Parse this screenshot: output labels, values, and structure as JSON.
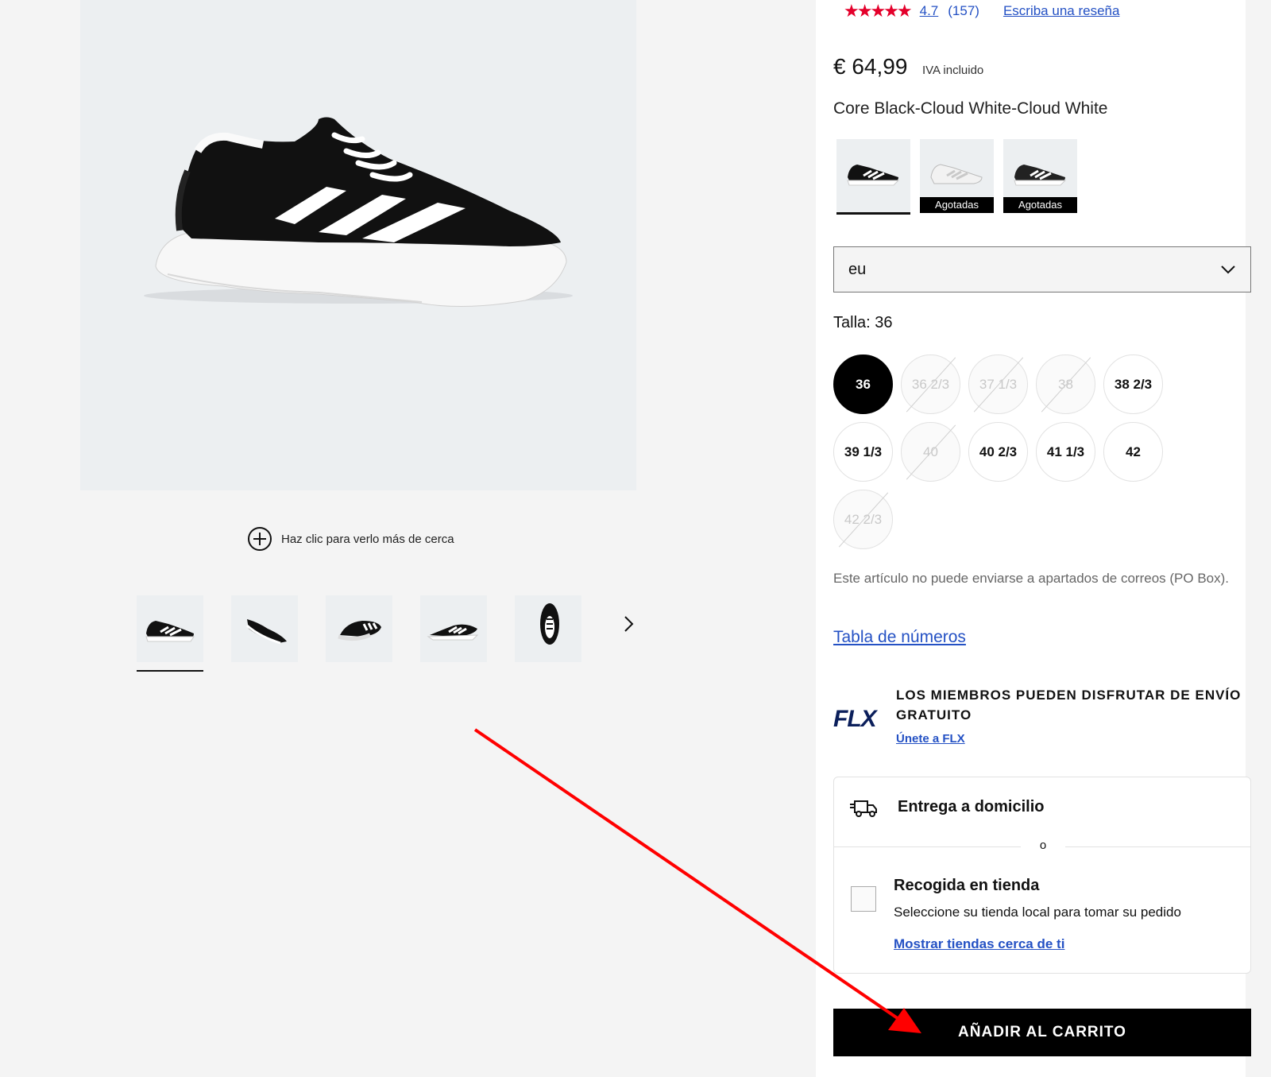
{
  "rating": {
    "stars": "★★★★★",
    "value": "4.7",
    "count": "(157)",
    "write_review": "Escriba una reseña"
  },
  "price": {
    "amount": "€ 64,99",
    "vat": "IVA incluido"
  },
  "color_name": "Core Black-Cloud White-Cloud White",
  "swatches": [
    {
      "tag": ""
    },
    {
      "tag": "Agotadas"
    },
    {
      "tag": "Agotadas"
    }
  ],
  "size_system": {
    "value": "eu"
  },
  "size_label": "Talla: 36",
  "sizes": [
    {
      "label": "36",
      "state": "selected"
    },
    {
      "label": "36 2/3",
      "state": "unavailable"
    },
    {
      "label": "37 1/3",
      "state": "unavailable"
    },
    {
      "label": "38",
      "state": "unavailable"
    },
    {
      "label": "38 2/3",
      "state": "available"
    },
    {
      "label": "39 1/3",
      "state": "available"
    },
    {
      "label": "40",
      "state": "unavailable"
    },
    {
      "label": "40 2/3",
      "state": "available"
    },
    {
      "label": "41 1/3",
      "state": "available"
    },
    {
      "label": "42",
      "state": "available"
    },
    {
      "label": "42 2/3",
      "state": "unavailable"
    }
  ],
  "notice": "Este artículo no puede enviarse a apartados de correos (PO Box).",
  "size_chart": "Tabla de números",
  "flx": {
    "logo": "FLX",
    "title": "LOS MIEMBROS PUEDEN DISFRUTAR DE ENVÍO GRATUITO",
    "join": "Únete a FLX"
  },
  "delivery": {
    "home": "Entrega a domicilio",
    "or": "o",
    "store_title": "Recogida en tienda",
    "store_desc": "Seleccione su tienda local para tomar su pedido",
    "store_link": "Mostrar tiendas cerca de ti"
  },
  "cart_button": "AÑADIR AL CARRITO",
  "gallery": {
    "zoom_text": "Haz clic para verlo más de cerca",
    "thumb_count": 5
  },
  "colors": {
    "accent_star": "#e4002b",
    "link": "#2451c4",
    "annotation_arrow": "#ff0000"
  }
}
